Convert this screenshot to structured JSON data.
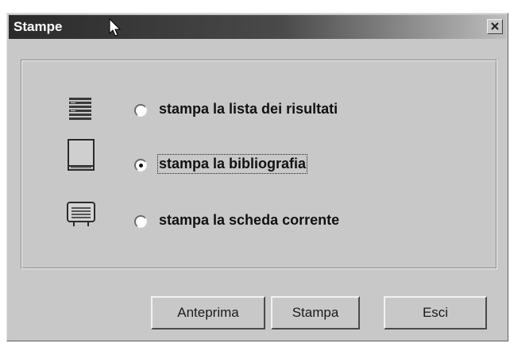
{
  "window": {
    "title": "Stampe"
  },
  "options": [
    {
      "label": "stampa la lista dei risultati",
      "icon": "list-icon",
      "selected": false
    },
    {
      "label": "stampa la bibliografia",
      "icon": "book-icon",
      "selected": true
    },
    {
      "label": "stampa la scheda corrente",
      "icon": "card-icon",
      "selected": false
    }
  ],
  "buttons": {
    "preview_label": "Anteprima",
    "print_label": "Stampa",
    "exit_label": "Esci"
  }
}
